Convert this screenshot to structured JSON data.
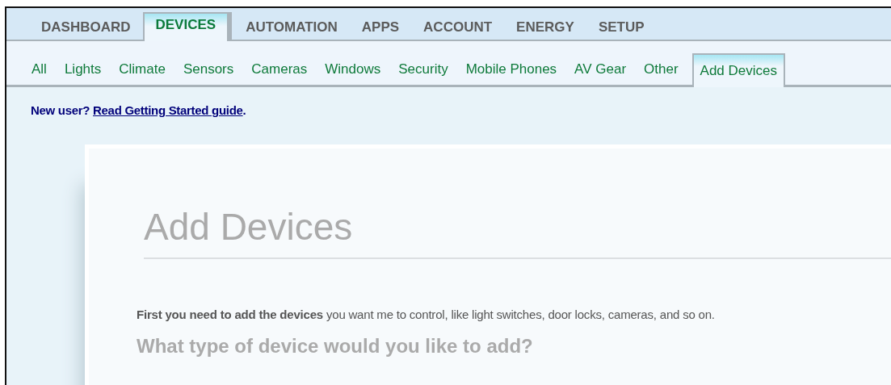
{
  "main_tabs": [
    {
      "label": "DASHBOARD",
      "selected": false
    },
    {
      "label": "DEVICES",
      "selected": true
    },
    {
      "label": "AUTOMATION",
      "selected": false
    },
    {
      "label": "APPS",
      "selected": false
    },
    {
      "label": "ACCOUNT",
      "selected": false
    },
    {
      "label": "ENERGY",
      "selected": false
    },
    {
      "label": "SETUP",
      "selected": false
    }
  ],
  "sub_tabs": [
    {
      "label": "All",
      "selected": false
    },
    {
      "label": "Lights",
      "selected": false
    },
    {
      "label": "Climate",
      "selected": false
    },
    {
      "label": "Sensors",
      "selected": false
    },
    {
      "label": "Cameras",
      "selected": false
    },
    {
      "label": "Windows",
      "selected": false
    },
    {
      "label": "Security",
      "selected": false
    },
    {
      "label": "Mobile Phones",
      "selected": false
    },
    {
      "label": "AV Gear",
      "selected": false
    },
    {
      "label": "Other",
      "selected": false
    },
    {
      "label": "Add Devices",
      "selected": true
    }
  ],
  "notice": {
    "prefix": "New user?",
    "link": "Read Getting Started guide",
    "suffix": "."
  },
  "panel": {
    "title": "Add Devices",
    "intro": "**First you need to add the devices** you want me to control, like light switches, door locks, cameras, and so on.",
    "question": "What type of device would you like to add?"
  }
}
